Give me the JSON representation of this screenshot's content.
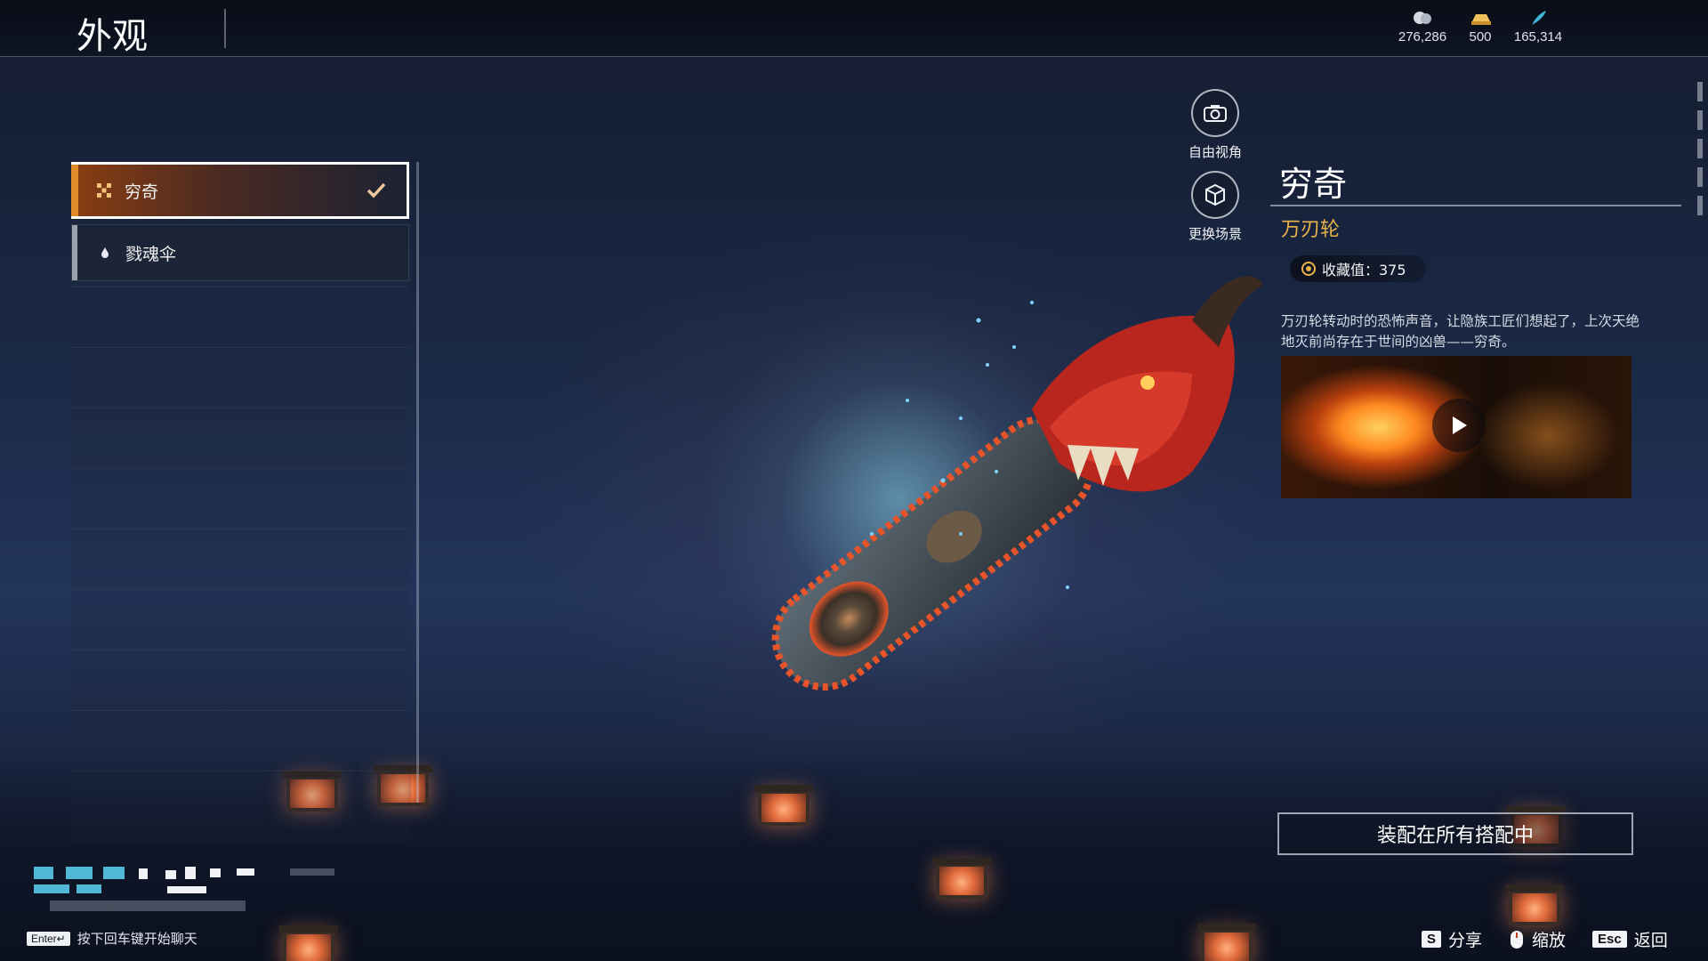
{
  "header": {
    "title": "外观",
    "currencies": [
      {
        "icon": "coin-pile-icon",
        "value": "276,286"
      },
      {
        "icon": "gold-ingot-icon",
        "value": "500"
      },
      {
        "icon": "feather-icon",
        "value": "165,314"
      }
    ]
  },
  "skin_list": {
    "items": [
      {
        "label": "穷奇",
        "icon": "pattern-icon",
        "selected": true
      },
      {
        "label": "戮魂伞",
        "icon": "drop-icon",
        "selected": false
      }
    ]
  },
  "tools": {
    "free_camera": "自由视角",
    "change_scene": "更换场景"
  },
  "detail": {
    "name": "穷奇",
    "type": "万刃轮",
    "collection_value": "收藏值：375",
    "description": "万刃轮转动时的恐怖声音，让隐族工匠们想起了，上次天绝地灭前尚存在于世间的凶兽——穷奇。",
    "equip_button": "装配在所有搭配中"
  },
  "bottom": {
    "chat_key": "Enter↵",
    "chat_hint": "按下回车键开始聊天",
    "actions": [
      {
        "key": "S",
        "label": "分享"
      },
      {
        "key": "mouse",
        "label": "缩放"
      },
      {
        "key": "Esc",
        "label": "返回"
      }
    ]
  },
  "colors": {
    "accent_orange": "#e08a2a",
    "item_type_gold": "#e9b24a"
  }
}
